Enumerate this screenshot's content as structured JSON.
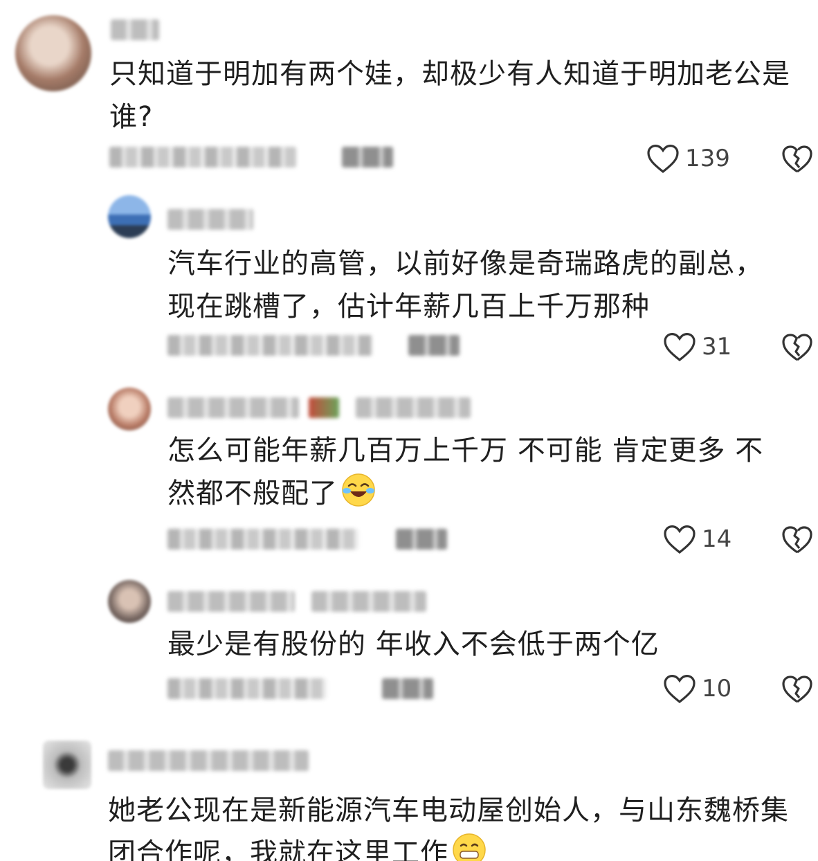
{
  "comments": [
    {
      "text": "只知道于明加有两个娃，却极少有人知道于明加老公是谁?",
      "likes": "139",
      "avatar_color": "#b58f7a"
    },
    {
      "text": "汽车行业的高管，以前好像是奇瑞路虎的副总，现在跳槽了，估计年薪几百上千万那种",
      "likes": "31",
      "avatar_color": "#5a8ccf"
    },
    {
      "text": "怎么可能年薪几百万上千万 不可能 肯定更多 不然都不般配了",
      "likes": "14",
      "avatar_color": "#c8907a",
      "emoji": "laugh-cry-emoji"
    },
    {
      "text": "最少是有股份的 年收入不会低于两个亿",
      "likes": "10",
      "avatar_color": "#7a6a64"
    },
    {
      "text": "她老公现在是新能源汽车电动屋创始人，与山东魏桥集团合作呢，我就在这里工作",
      "avatar_color": "#9a9a9a",
      "emoji": "grin-emoji"
    }
  ],
  "icons": {
    "like": "heart-outline-icon",
    "dislike": "broken-heart-icon"
  }
}
